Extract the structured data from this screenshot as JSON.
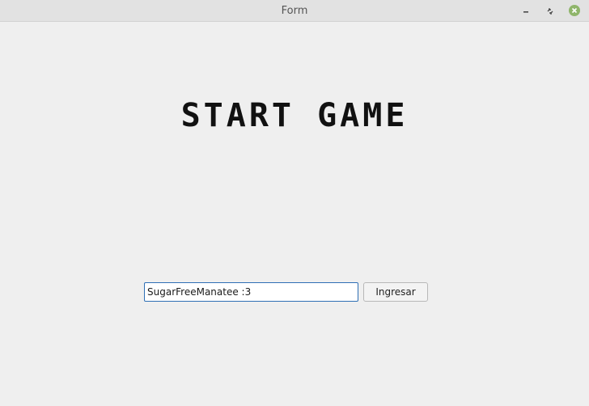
{
  "window": {
    "title": "Form",
    "controls": {
      "minimize_icon": "minimize-icon",
      "maximize_icon": "restore-icon",
      "close_icon": "close-icon",
      "close_color": "#8fb56a"
    }
  },
  "main": {
    "heading": "START GAME",
    "name_input": {
      "value": "SugarFreeManatee :3",
      "placeholder": ""
    },
    "submit_label": "Ingresar"
  },
  "colors": {
    "background": "#efefef",
    "heading": "#111111",
    "input_border": "#2f6fb5"
  }
}
